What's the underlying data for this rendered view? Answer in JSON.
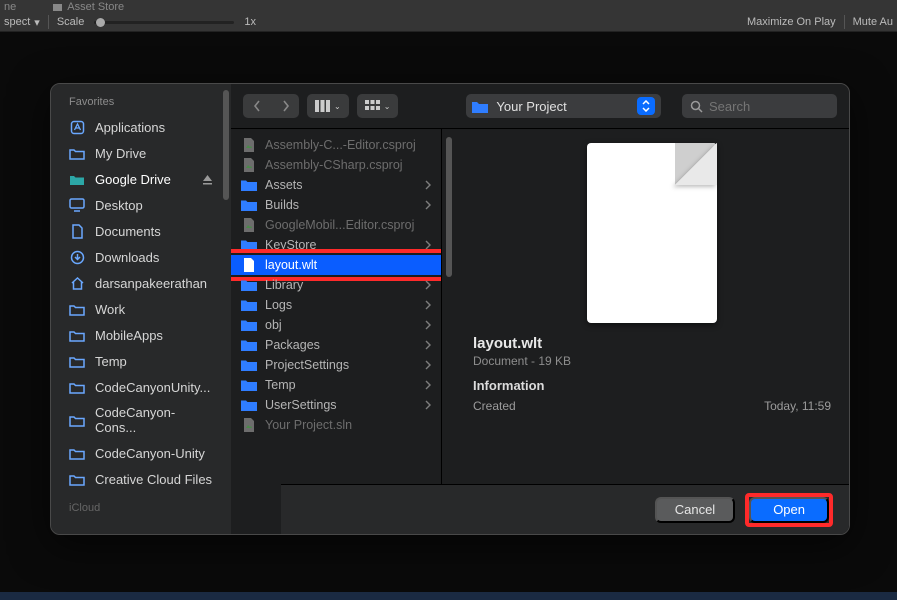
{
  "topbar": {
    "tab1": "ne",
    "assetStore": "Asset Store",
    "aspect": "spect",
    "scale": "Scale",
    "scaleVal": "1x",
    "maxPlay": "Maximize On Play",
    "muteAu": "Mute Au"
  },
  "sidebar": {
    "heading1": "Favorites",
    "items": [
      {
        "icon": "app",
        "label": "Applications"
      },
      {
        "icon": "folder",
        "label": "My Drive"
      },
      {
        "icon": "gdrive",
        "label": "Google Drive",
        "eject": true,
        "active": true
      },
      {
        "icon": "desktop",
        "label": "Desktop"
      },
      {
        "icon": "doc",
        "label": "Documents"
      },
      {
        "icon": "download",
        "label": "Downloads"
      },
      {
        "icon": "home",
        "label": "darsanpakeerathan"
      },
      {
        "icon": "folder",
        "label": "Work"
      },
      {
        "icon": "folder",
        "label": "MobileApps"
      },
      {
        "icon": "folder",
        "label": "Temp"
      },
      {
        "icon": "folder",
        "label": "CodeCanyonUnity..."
      },
      {
        "icon": "folder",
        "label": "CodeCanyon-Cons..."
      },
      {
        "icon": "folder",
        "label": "CodeCanyon-Unity"
      },
      {
        "icon": "folder",
        "label": "Creative Cloud Files"
      }
    ],
    "heading2": "iCloud"
  },
  "toolbar": {
    "pathLabel": "Your Project",
    "searchPlaceholder": "Search"
  },
  "files": [
    {
      "kind": "doc",
      "dim": true,
      "label": "Assembly-C...-Editor.csproj"
    },
    {
      "kind": "doc",
      "dim": true,
      "label": "Assembly-CSharp.csproj"
    },
    {
      "kind": "folder",
      "label": "Assets",
      "chev": true
    },
    {
      "kind": "folder",
      "label": "Builds",
      "chev": true
    },
    {
      "kind": "doc",
      "dim": true,
      "label": "GoogleMobil...Editor.csproj"
    },
    {
      "kind": "folder",
      "label": "KeyStore",
      "chev": true
    },
    {
      "kind": "file",
      "label": "layout.wlt",
      "selected": true,
      "highlighted": true
    },
    {
      "kind": "folder",
      "label": "Library",
      "chev": true
    },
    {
      "kind": "folder",
      "label": "Logs",
      "chev": true
    },
    {
      "kind": "folder",
      "label": "obj",
      "chev": true
    },
    {
      "kind": "folder",
      "label": "Packages",
      "chev": true
    },
    {
      "kind": "folder",
      "label": "ProjectSettings",
      "chev": true
    },
    {
      "kind": "folder",
      "label": "Temp",
      "chev": true
    },
    {
      "kind": "folder",
      "label": "UserSettings",
      "chev": true
    },
    {
      "kind": "doc",
      "dim": true,
      "label": "Your Project.sln"
    }
  ],
  "preview": {
    "title": "layout.wlt",
    "subtitle": "Document - 19 KB",
    "infoHeading": "Information",
    "createdLabel": "Created",
    "createdValue": "Today, 11:59"
  },
  "footer": {
    "cancel": "Cancel",
    "open": "Open"
  }
}
